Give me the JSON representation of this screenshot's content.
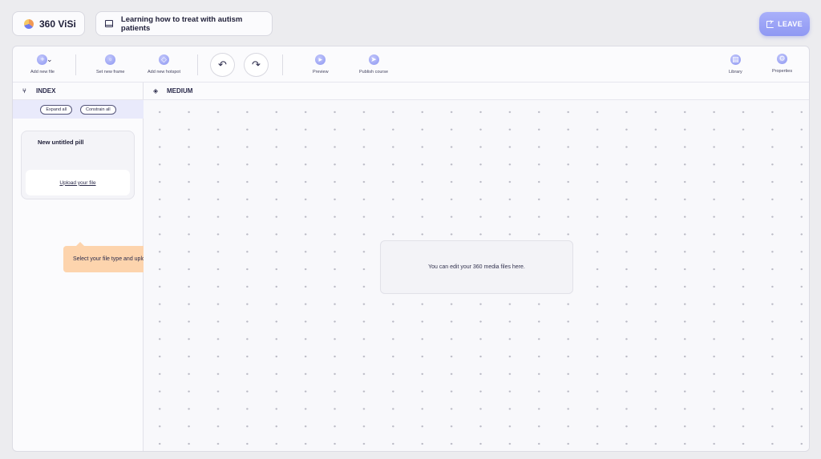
{
  "app": {
    "name": "360 ViSi",
    "course_title": "Learning how to treat with autism patients",
    "leave_label": "LEAVE"
  },
  "toolbar": {
    "add_new_file": "Add new file",
    "set_new_frame": "Set new frame",
    "add_new_hotspot": "Add new hotspot",
    "undo_icon": "undo-icon",
    "redo_icon": "redo-icon",
    "preview": "Preview",
    "publish_course": "Publish course",
    "library": "Library",
    "properties": "Properties"
  },
  "index": {
    "title": "INDEX",
    "expand_all": "Expand all",
    "constrain_all": "Constrain all"
  },
  "medium": {
    "title": "MEDIUM",
    "hint": "You can edit your 360 media files here."
  },
  "file_card": {
    "name": "New untitled pill",
    "upload_link": "Upload your file"
  },
  "tooltip": {
    "text": "Select your file type and upload your file"
  },
  "colors": {
    "accent": "#8f98f3",
    "tooltip_bg": "#fdd4ad",
    "index_row_bg": "#e9eafb"
  }
}
